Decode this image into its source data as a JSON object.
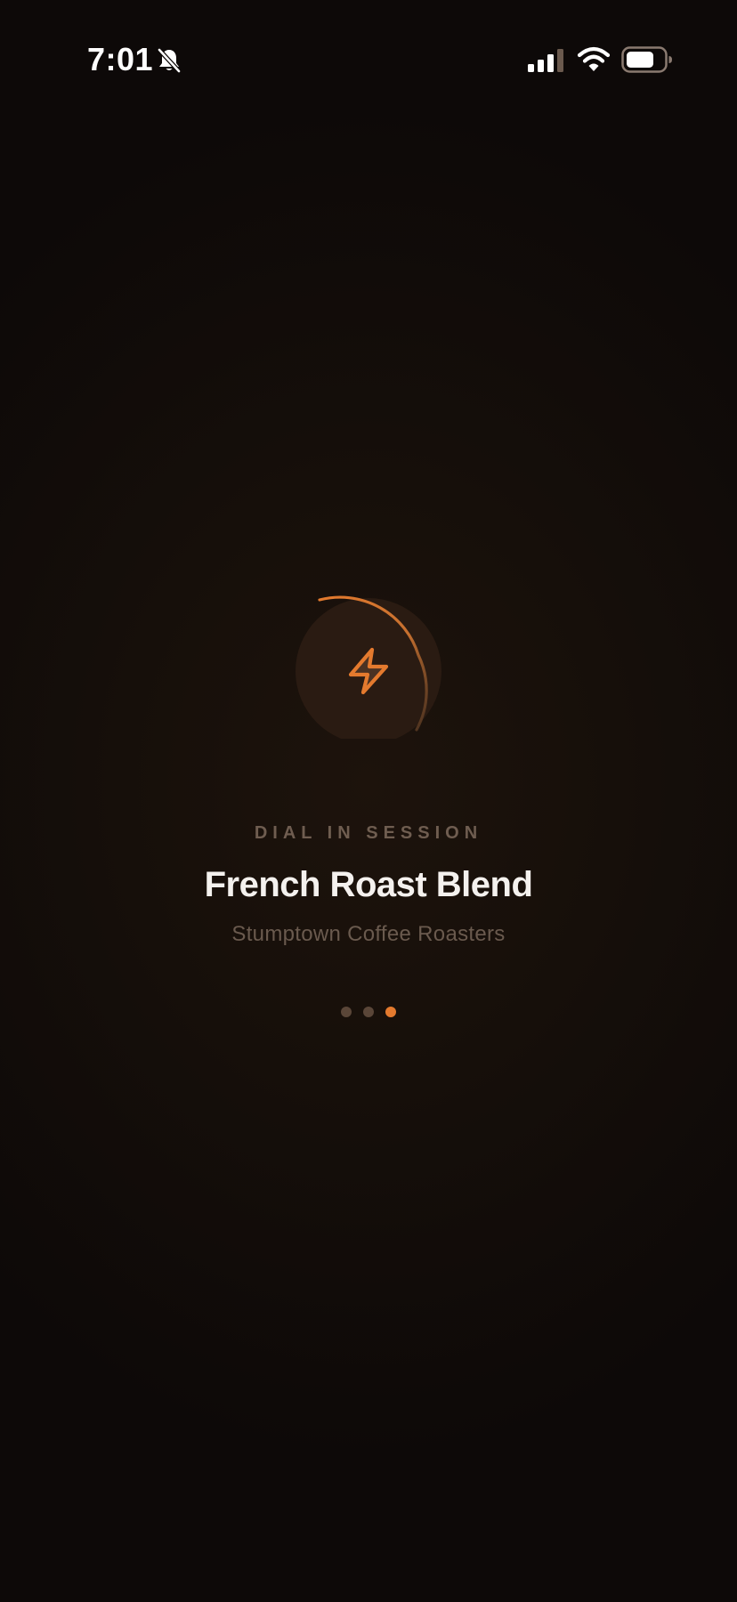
{
  "status_bar": {
    "time": "7:01",
    "icons": [
      "bell-slash-icon",
      "signal-icon",
      "wifi-icon",
      "battery-icon"
    ]
  },
  "loader": {
    "icon": "bolt-icon",
    "accent_color": "#e47a2e",
    "track_color": "#2b1d14"
  },
  "session": {
    "label": "DIAL IN SESSION",
    "coffee_name": "French Roast Blend",
    "roaster": "Stumptown Coffee Roasters"
  },
  "pager": {
    "count": 3,
    "active_index": 2,
    "active_color": "#e47a2e",
    "inactive_color": "#5a4638"
  },
  "colors": {
    "background": "#140e0a",
    "title": "#f4f1ee",
    "muted": "#6f5d50"
  }
}
